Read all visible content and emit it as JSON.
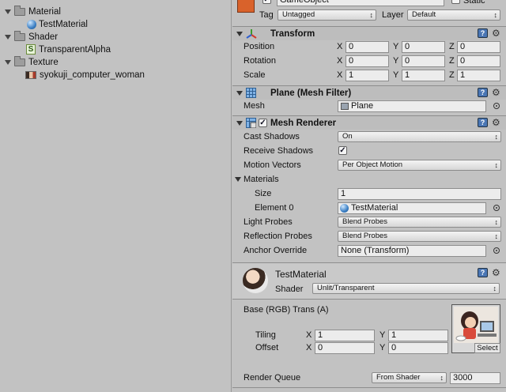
{
  "project": {
    "items": [
      {
        "label": "Material",
        "icon": "folder-icon"
      },
      {
        "label": "TestMaterial",
        "icon": "material-sphere-icon"
      },
      {
        "label": "Shader",
        "icon": "folder-icon"
      },
      {
        "label": "TransparentAlpha",
        "icon": "shader-icon"
      },
      {
        "label": "Texture",
        "icon": "folder-icon"
      },
      {
        "label": "syokuji_computer_woman",
        "icon": "texture-icon"
      }
    ]
  },
  "gameobject": {
    "name": "GameObject",
    "static_label": "Static",
    "tag_label": "Tag",
    "tag_value": "Untagged",
    "layer_label": "Layer",
    "layer_value": "Default"
  },
  "transform": {
    "title": "Transform",
    "rows": [
      {
        "label": "Position",
        "x": "0",
        "y": "0",
        "z": "0"
      },
      {
        "label": "Rotation",
        "x": "0",
        "y": "0",
        "z": "0"
      },
      {
        "label": "Scale",
        "x": "1",
        "y": "1",
        "z": "1"
      }
    ],
    "axis": {
      "x": "X",
      "y": "Y",
      "z": "Z"
    }
  },
  "mesh_filter": {
    "title": "Plane (Mesh Filter)",
    "mesh_label": "Mesh",
    "mesh_value": "Plane"
  },
  "mesh_renderer": {
    "title": "Mesh Renderer",
    "cast_shadows_label": "Cast Shadows",
    "cast_shadows_value": "On",
    "receive_shadows_label": "Receive Shadows",
    "receive_shadows_checked": true,
    "motion_vectors_label": "Motion Vectors",
    "motion_vectors_value": "Per Object Motion",
    "materials_label": "Materials",
    "size_label": "Size",
    "size_value": "1",
    "element0_label": "Element 0",
    "element0_value": "TestMaterial",
    "light_probes_label": "Light Probes",
    "light_probes_value": "Blend Probes",
    "reflection_probes_label": "Reflection Probes",
    "reflection_probes_value": "Blend Probes",
    "anchor_override_label": "Anchor Override",
    "anchor_override_value": "None (Transform)"
  },
  "material": {
    "name": "TestMaterial",
    "shader_label": "Shader",
    "shader_value": "Unlit/Transparent",
    "base_label": "Base (RGB) Trans (A)",
    "tiling_label": "Tiling",
    "offset_label": "Offset",
    "tiling_x": "1",
    "tiling_y": "1",
    "offset_x": "0",
    "offset_y": "0",
    "select_label": "Select",
    "render_queue_label": "Render Queue",
    "render_queue_mode": "From Shader",
    "render_queue_value": "3000"
  },
  "colors": {
    "panel_bg": "#c2c2c2",
    "header_bg": "#bdbdbd",
    "field_bg": "#ececec",
    "accent_blue": "#3b7fc4"
  }
}
